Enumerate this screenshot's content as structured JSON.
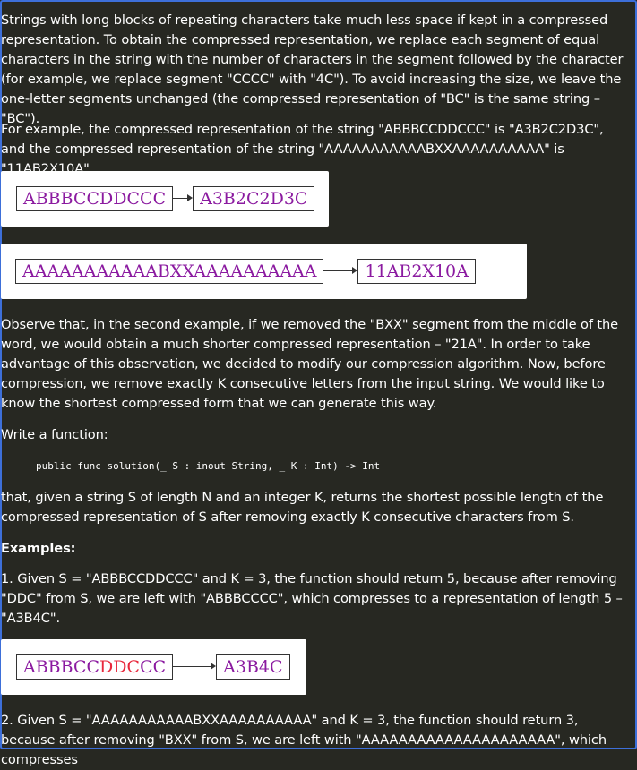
{
  "paragraphs": {
    "intro": "Strings with long blocks of repeating characters take much less space if kept in a compressed representation. To obtain the compressed representation, we replace each segment of equal characters in the string with the number of characters in the segment followed by the character (for example, we replace segment \"CCCC\" with \"4C\"). To avoid increasing the size, we leave the one-letter segments unchanged (the compressed representation of \"BC\" is the same string – \"BC\").",
    "example_intro": "For example, the compressed representation of the string \"ABBBCCDDCCC\" is \"A3B2C2D3C\", and the compressed representation of the string \"AAAAAAAAAAABXXAAAAAAAAAA\" is \"11AB2X10A\".",
    "observe": "Observe that, in the second example, if we removed the \"BXX\" segment from the middle of the word, we would obtain a much shorter compressed representation – \"21A\". In order to take advantage of this observation, we decided to modify our compression algorithm. Now, before compression, we remove exactly K consecutive letters from the input string. We would like to know the shortest compressed form that we can generate this way.",
    "write": "Write a function:",
    "signature": "public func solution(_ S : inout String, _ K : Int) -> Int",
    "that_given": "that, given a string S of length N and an integer K, returns the shortest possible length of the compressed representation of S after removing exactly K consecutive characters from S.",
    "examples_heading": "Examples:",
    "example1": "1. Given S = \"ABBBCCDDCCC\" and K = 3, the function should return 5, because after removing \"DDC\" from S, we are left with \"ABBBCCCC\", which compresses to a representation of length 5 – \"A3B4C\".",
    "example2": "2. Given S = \"AAAAAAAAAAABXXAAAAAAAAAA\" and K = 3, the function should return 3, because after removing \"BXX\" from S, we are left with \"AAAAAAAAAAAAAAAAAAAAA\", which compresses"
  },
  "diagrams": {
    "d1": {
      "source": "ABBBCCDDCCC",
      "result": "A3B2C2D3C"
    },
    "d2": {
      "source": "AAAAAAAAAAABXXAAAAAAAAAA",
      "result": "11AB2X10A"
    },
    "d3": {
      "source_a": "ABBBCC",
      "source_red": "DDC",
      "source_b": "CC",
      "result": "A3B4C"
    }
  },
  "colors": {
    "background": "#272822",
    "text": "#ffffff",
    "diagram_text": "#8b1aa0",
    "removed_highlight": "#e8283c",
    "frame_border": "#3d6fd9"
  }
}
